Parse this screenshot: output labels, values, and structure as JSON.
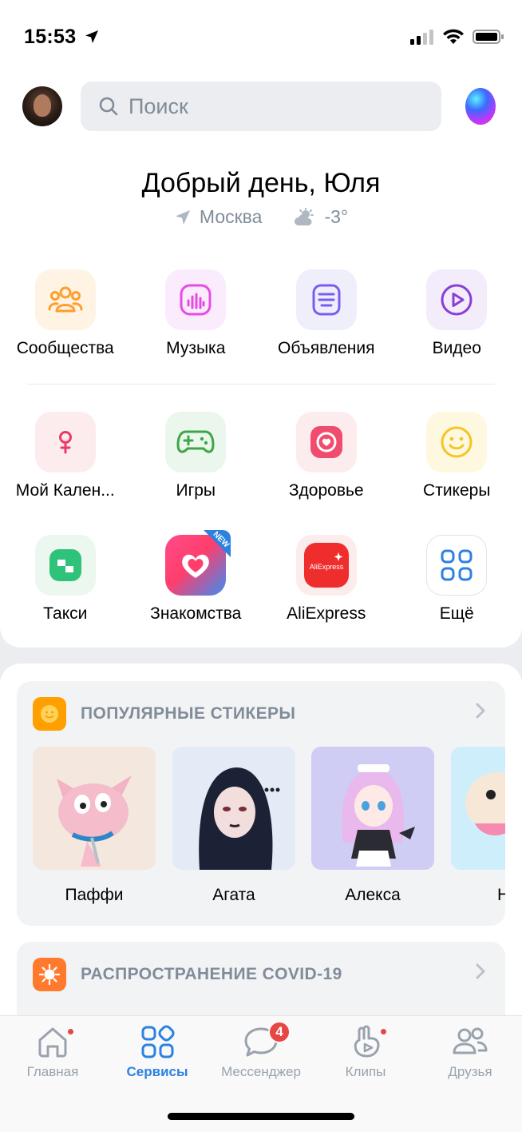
{
  "status": {
    "time": "15:53"
  },
  "header": {
    "search_placeholder": "Поиск",
    "greeting": "Добрый день, Юля",
    "city": "Москва",
    "temperature": "-3°"
  },
  "services": [
    {
      "label": "Сообщества",
      "icon": "users-icon",
      "bg": "#fff3e4"
    },
    {
      "label": "Музыка",
      "icon": "music-icon",
      "bg": "#fbecfd"
    },
    {
      "label": "Объявления",
      "icon": "classifieds-icon",
      "bg": "#efeffc"
    },
    {
      "label": "Видео",
      "icon": "video-icon",
      "bg": "#f3ecfb"
    },
    {
      "label": "Мой Кален...",
      "icon": "calendar-female-icon",
      "bg": "#fdecee"
    },
    {
      "label": "Игры",
      "icon": "gamepad-icon",
      "bg": "#ebf7ec"
    },
    {
      "label": "Здоровье",
      "icon": "health-icon",
      "bg": "#fdecee"
    },
    {
      "label": "Стикеры",
      "icon": "smile-icon",
      "bg": "#fff8e1"
    },
    {
      "label": "Такси",
      "icon": "taxi-icon",
      "bg": "#ebf7ef"
    },
    {
      "label": "Знакомства",
      "icon": "dating-icon",
      "bg": "#fdecee"
    },
    {
      "label": "AliExpress",
      "icon": "aliexpress-icon",
      "bg": "#fdecec"
    },
    {
      "label": "Ещё",
      "icon": "more-grid-icon",
      "bg": "#ffffff"
    }
  ],
  "badges": {
    "new": "NEW",
    "aliexpress": "AliExpress"
  },
  "popular_stickers": {
    "title": "ПОПУЛЯРНЫЕ СТИКЕРЫ",
    "items": [
      {
        "name": "Паффи"
      },
      {
        "name": "Агата"
      },
      {
        "name": "Алекса"
      },
      {
        "name": "Нуб"
      }
    ]
  },
  "covid": {
    "title": "РАСПРОСТРАНЕНИЕ COVID-19"
  },
  "tabs": [
    {
      "label": "Главная",
      "active": false
    },
    {
      "label": "Сервисы",
      "active": true
    },
    {
      "label": "Мессенджер",
      "active": false,
      "badge": "4"
    },
    {
      "label": "Клипы",
      "active": false
    },
    {
      "label": "Друзья",
      "active": false
    }
  ],
  "colors": {
    "accent": "#2d81e0",
    "secondary_text": "#818c99",
    "notification": "#e64646"
  }
}
